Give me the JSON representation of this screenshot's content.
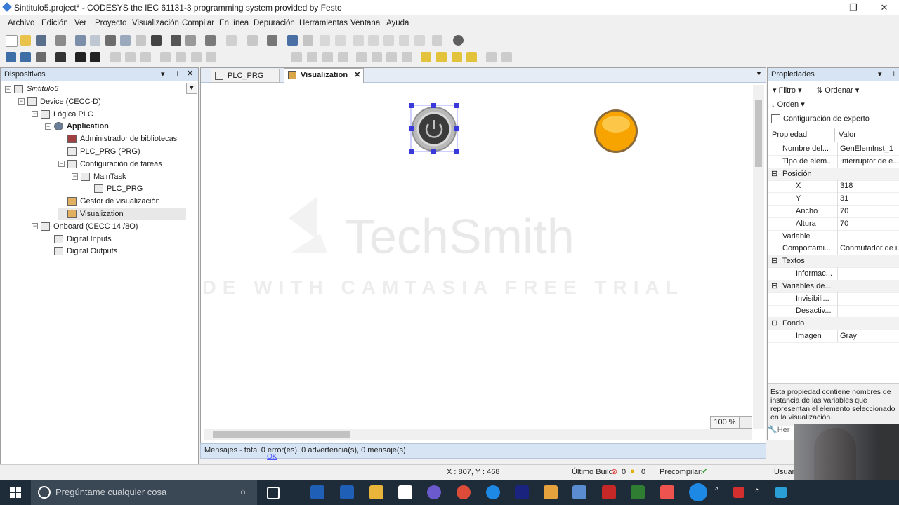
{
  "window": {
    "title": "Sintitulo5.project* - CODESYS the IEC 61131-3 programming system provided by Festo"
  },
  "menu": [
    "Archivo",
    "Edición",
    "Ver",
    "Proyecto",
    "Visualización",
    "Compilar",
    "En línea",
    "Depuración",
    "Herramientas",
    "Ventana",
    "Ayuda"
  ],
  "devices": {
    "title": "Dispositivos",
    "tree": [
      {
        "label": "Sintitulo5",
        "level": 0
      },
      {
        "label": "Device (CECC-D)",
        "level": 1
      },
      {
        "label": "Lógica PLC",
        "level": 2
      },
      {
        "label": "Application",
        "level": 3
      },
      {
        "label": "Administrador de bibliotecas",
        "level": 4
      },
      {
        "label": "PLC_PRG (PRG)",
        "level": 4
      },
      {
        "label": "Configuración de tareas",
        "level": 4
      },
      {
        "label": "MainTask",
        "level": 5
      },
      {
        "label": "PLC_PRG",
        "level": 6
      },
      {
        "label": "Gestor de visualización",
        "level": 4
      },
      {
        "label": "Visualization",
        "level": 4
      },
      {
        "label": "Onboard (CECC 14I/8O)",
        "level": 2
      },
      {
        "label": "Digital Inputs",
        "level": 3
      },
      {
        "label": "Digital Outputs",
        "level": 3
      }
    ]
  },
  "editor": {
    "tabs": [
      "PLC_PRG",
      "Visualization"
    ],
    "zoom": "100 %",
    "watermark1": "TechSmith",
    "watermark2": "MADE WITH CAMTASIA FREE TRIAL"
  },
  "properties": {
    "title": "Propiedades",
    "filter": "Filtro",
    "sort": "Ordenar",
    "order": "Orden",
    "expert": "Configuración de experto",
    "col_prop": "Propiedad",
    "col_val": "Valor",
    "rows": [
      {
        "name": "Nombre del...",
        "value": "GenElemInst_1",
        "cat": false,
        "indent": 1
      },
      {
        "name": "Tipo de elem...",
        "value": "Interruptor de e...",
        "cat": false,
        "indent": 1
      },
      {
        "name": "Posición",
        "value": "",
        "cat": true,
        "indent": 1
      },
      {
        "name": "X",
        "value": "318",
        "cat": false,
        "indent": 2
      },
      {
        "name": "Y",
        "value": "31",
        "cat": false,
        "indent": 2
      },
      {
        "name": "Ancho",
        "value": "70",
        "cat": false,
        "indent": 2
      },
      {
        "name": "Altura",
        "value": "70",
        "cat": false,
        "indent": 2
      },
      {
        "name": "Variable",
        "value": "",
        "cat": false,
        "indent": 1
      },
      {
        "name": "Comportami...",
        "value": "Conmutador de i...",
        "cat": false,
        "indent": 1
      },
      {
        "name": "Textos",
        "value": "",
        "cat": true,
        "indent": 1
      },
      {
        "name": "Informac...",
        "value": "",
        "cat": false,
        "indent": 2
      },
      {
        "name": "Variables de...",
        "value": "",
        "cat": true,
        "indent": 1
      },
      {
        "name": "Invisibili...",
        "value": "",
        "cat": false,
        "indent": 2
      },
      {
        "name": "Desactiv...",
        "value": "",
        "cat": false,
        "indent": 2
      },
      {
        "name": "Fondo",
        "value": "",
        "cat": true,
        "indent": 1
      },
      {
        "name": "Imagen",
        "value": "Gray",
        "cat": false,
        "indent": 2
      }
    ],
    "description": "Esta propiedad contiene nombres de instancia de las variables que representan el elemento seleccionado en la visualización.",
    "herr": "Her"
  },
  "messages": {
    "text": "Mensajes - total 0 error(es), 0 advertencia(s), 0 mensaje(s)",
    "ok": "OK"
  },
  "status": {
    "coords": "X : 807, Y : 468",
    "last_build": "Último Build",
    "errors": "0",
    "warnings": "0",
    "precompile": "Precompilar:",
    "user": "Usuar"
  },
  "taskbar": {
    "search_placeholder": "Pregúntame cualquier cosa"
  }
}
